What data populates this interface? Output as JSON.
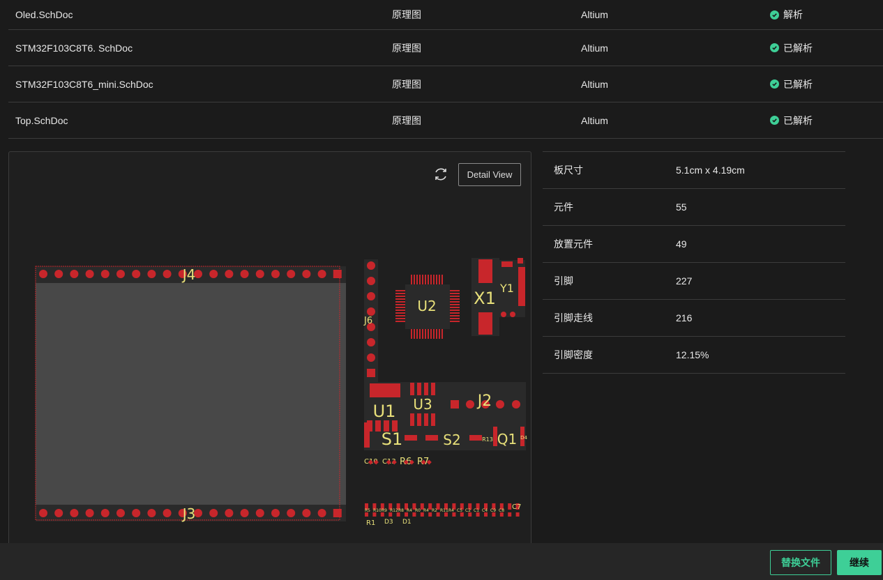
{
  "files": [
    {
      "name": "Oled.SchDoc",
      "type": "原理图",
      "tool": "Altium",
      "status": "解析"
    },
    {
      "name": "STM32F103C8T6. SchDoc",
      "type": "原理图",
      "tool": "Altium",
      "status": "已解析"
    },
    {
      "name": "STM32F103C8T6_mini.SchDoc",
      "type": "原理图",
      "tool": "Altium",
      "status": "已解析"
    },
    {
      "name": "Top.SchDoc",
      "type": "原理图",
      "tool": "Altium",
      "status": "已解析"
    }
  ],
  "preview": {
    "detail_label": "Detail View",
    "refresh_icon": "refresh-icon",
    "designators": {
      "J4": "J4",
      "J3": "J3",
      "J6": "J6",
      "U2": "U2",
      "X1": "X1",
      "Y1": "Y1",
      "U1": "U1",
      "U3": "U3",
      "J2": "J2",
      "S1": "S1",
      "S2": "S2",
      "R13": "R13",
      "Q1": "Q1",
      "D4": "D4",
      "C10": "C10",
      "C13": "C13",
      "R6": "R6",
      "R7": "R7",
      "C7": "C7",
      "R1": "R1",
      "D3": "D3",
      "D1": "D1"
    },
    "small_labels": [
      "R5",
      "R10",
      "R9",
      "R12",
      "R8",
      "R4",
      "R0",
      "R4",
      "R2",
      "R11",
      "R4",
      "C5",
      "C2",
      "C1",
      "C4",
      "C9",
      "C8"
    ]
  },
  "stats": [
    {
      "label": "板尺寸",
      "value": "5.1cm x 4.19cm"
    },
    {
      "label": "元件",
      "value": "55"
    },
    {
      "label": "放置元件",
      "value": "49"
    },
    {
      "label": "引脚",
      "value": "227"
    },
    {
      "label": "引脚走线",
      "value": "216"
    },
    {
      "label": "引脚密度",
      "value": "12.15%"
    }
  ],
  "footer": {
    "replace_label": "替换文件",
    "continue_label": "继续"
  },
  "colors": {
    "accent": "#3ecf97",
    "pad": "#c8262b",
    "silkscreen": "#e8e07a",
    "background": "#1b1b1b"
  }
}
